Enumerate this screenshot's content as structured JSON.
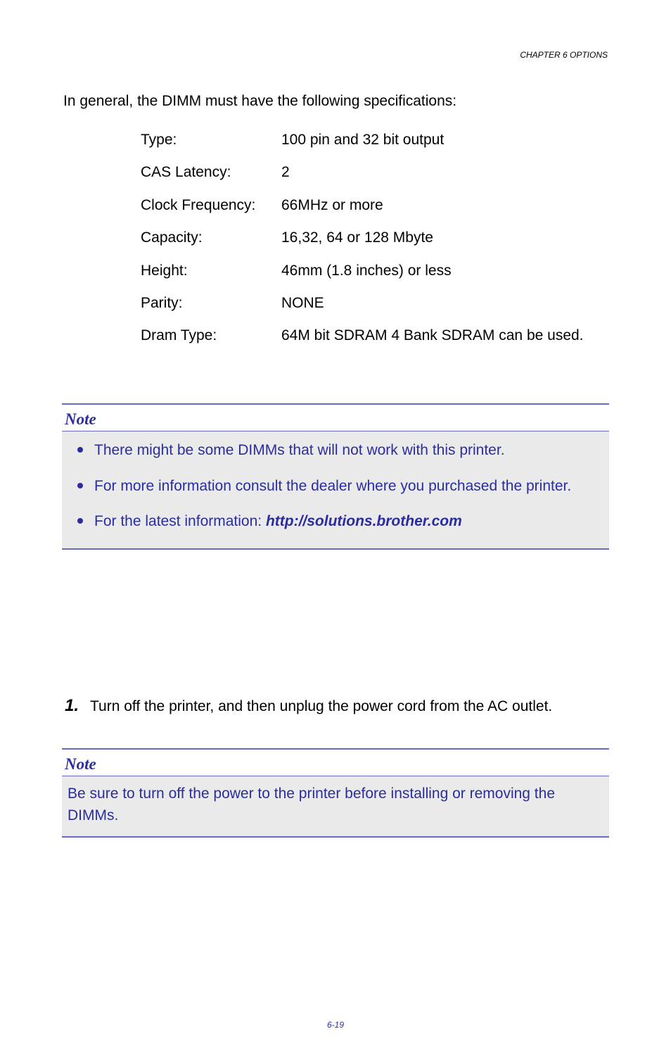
{
  "runningHeader": "CHAPTER 6 OPTIONS",
  "introText": "In general, the DIMM must have the following specifications:",
  "specs": [
    {
      "label": "Type:",
      "value": "100 pin and 32 bit output"
    },
    {
      "label": "CAS Latency:",
      "value": "2"
    },
    {
      "label": "Clock Frequency:",
      "value": "66MHz or more"
    },
    {
      "label": "Capacity:",
      "value": "16,32, 64 or 128 Mbyte"
    },
    {
      "label": "Height:",
      "value": "46mm (1.8 inches) or less"
    },
    {
      "label": "Parity:",
      "value": "NONE"
    },
    {
      "label": "Dram Type:",
      "value": "64M bit SDRAM 4 Bank SDRAM can be used."
    }
  ],
  "note1": {
    "title": "Note",
    "items": [
      {
        "text": "There might be some DIMMs that will not work with this printer."
      },
      {
        "text": "For more information consult the dealer where you purchased the printer."
      },
      {
        "prefix": "For the latest information: ",
        "link": "http://solutions.brother.com"
      }
    ]
  },
  "step": {
    "num": "1.",
    "text": "Turn off the printer, and then unplug the power cord from the AC outlet."
  },
  "note2": {
    "title": "Note",
    "text": "Be sure to turn off the power to the printer before installing or removing the DIMMs."
  },
  "pageNumber": "6-19"
}
